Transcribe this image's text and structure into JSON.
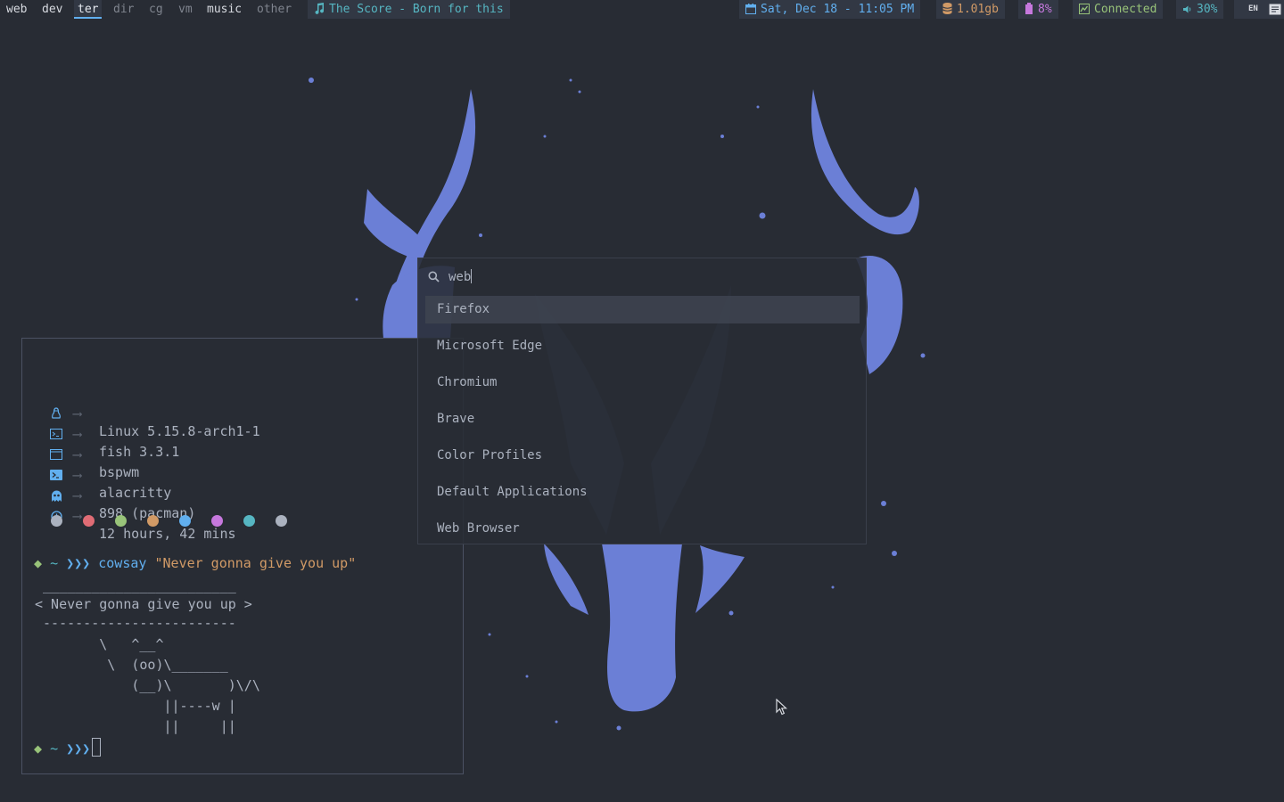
{
  "bar": {
    "workspaces": [
      {
        "name": "web",
        "state": "occupied"
      },
      {
        "name": "dev",
        "state": "occupied"
      },
      {
        "name": "ter",
        "state": "active"
      },
      {
        "name": "dir",
        "state": "empty"
      },
      {
        "name": "cg",
        "state": "empty"
      },
      {
        "name": "vm",
        "state": "empty"
      },
      {
        "name": "music",
        "state": "occupied"
      },
      {
        "name": "other",
        "state": "empty"
      }
    ],
    "now_playing": "The Score - Born for this",
    "date": "Sat, Dec 18 - 11:05 PM",
    "memory": "1.01gb",
    "battery": "8%",
    "network": "Connected",
    "volume": "30%",
    "keyboard_layout": "EN"
  },
  "terminal": {
    "info": [
      {
        "icon": "tux-icon",
        "value": "Linux 5.15.8-arch1-1"
      },
      {
        "icon": "shell-icon",
        "value": "fish 3.3.1"
      },
      {
        "icon": "window-icon",
        "value": "bspwm"
      },
      {
        "icon": "terminal-icon",
        "value": "alacritty"
      },
      {
        "icon": "ghost-icon",
        "value": "898 (pacman)"
      },
      {
        "icon": "clock-icon",
        "value": "12 hours, 42 mins"
      }
    ],
    "arrow": "⟶",
    "palette": [
      "#abb2bf",
      "#e06c75",
      "#98c379",
      "#d19a66",
      "#61afef",
      "#c678dd",
      "#56b6c2",
      "#abb2bf"
    ],
    "prompt_symbol": "◆",
    "prompt_dir": "~",
    "prompt_chevrons": "❯❯❯",
    "command": "cowsay",
    "argument": "\"Never gonna give you up\"",
    "cowsay_output": [
      " ________________________",
      "< Never gonna give you up >",
      " ------------------------",
      "        \\   ^__^",
      "         \\  (oo)\\_______",
      "            (__)\\       )\\/\\",
      "                ||----w |",
      "                ||     ||"
    ]
  },
  "launcher": {
    "query": "web",
    "results": [
      "Firefox",
      "Microsoft Edge",
      "Chromium",
      "Brave",
      "Color Profiles",
      "Default Applications",
      "Web Browser"
    ],
    "selected_index": 0
  },
  "colors": {
    "background": "#282c34",
    "accent": "#61afef",
    "wallpaper": "#6b7fd6",
    "green": "#98c379",
    "yellow": "#e5c07b",
    "cyan": "#56b6c2",
    "orange": "#d19a66",
    "magenta": "#c678dd"
  }
}
